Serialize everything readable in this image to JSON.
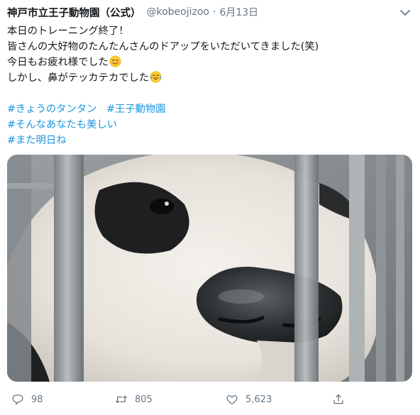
{
  "header": {
    "display_name": "神戸市立王子動物園（公式）",
    "handle": "@kobeojizoo",
    "separator": "·",
    "date": "6月13日"
  },
  "tweet": {
    "lines": [
      "本日のトレーニング終了！",
      "皆さんの大好物のたんたんさんのドアップをいただいてきました(笑)",
      "今日もお疲れ様でした",
      "しかし、鼻がテッカテカでした"
    ],
    "hashtag_rows": [
      [
        "#きょうのタンタン",
        "#王子動物園"
      ],
      [
        "#そんなあなたも美しい"
      ],
      [
        "#また明日ね"
      ]
    ]
  },
  "actions": {
    "reply_count": "98",
    "retweet_count": "805",
    "like_count": "5,623"
  },
  "icons": {
    "caret": "chevron-down-icon",
    "smile_emoji": "smiling-face-emoji",
    "laugh_emoji": "tears-of-joy-emoji",
    "reply": "reply-icon",
    "retweet": "retweet-icon",
    "like": "heart-icon",
    "share": "share-icon"
  },
  "colors": {
    "text": "#14171a",
    "secondary": "#657786",
    "link": "#1b95e0"
  }
}
